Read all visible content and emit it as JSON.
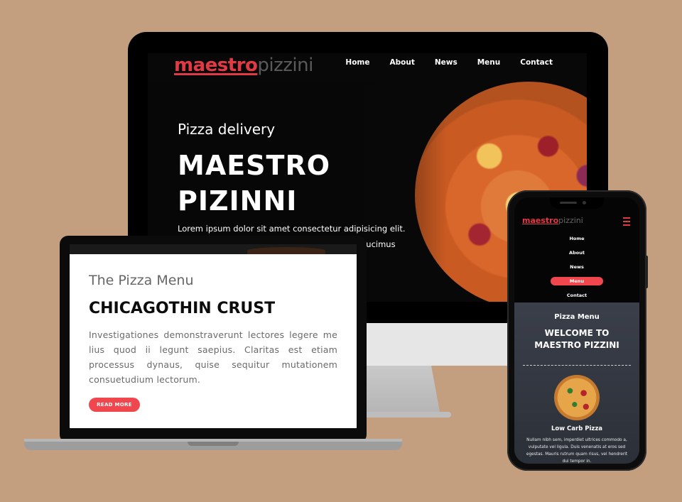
{
  "desktop": {
    "logo": {
      "part1": "maestro",
      "part2": "pizzini"
    },
    "nav": [
      "Home",
      "About",
      "News",
      "Menu",
      "Contact"
    ],
    "hero": {
      "subtitle": "Pizza delivery",
      "title_line1": "MAESTRO",
      "title_line2": "PIZINNI",
      "text": "Lorem ipsum dolor sit amet consectetur adipisicing elit.",
      "text2": "ducimus"
    }
  },
  "laptop": {
    "kicker": "The Pizza Menu",
    "title": "CHICAGOTHIN CRUST",
    "body": "Investigationes demonstraverunt lectores legere me lius quod ii legunt saepius. Claritas est etiam processus dynaus, quise sequitur mutationem consuetudium lectorum.",
    "button": "READ MORE"
  },
  "phone": {
    "logo": {
      "part1": "maestro",
      "part2": "pizzini"
    },
    "nav": [
      "Home",
      "About",
      "News",
      "Menu",
      "Contact"
    ],
    "active_nav": "Menu",
    "hero": {
      "kicker": "Pizza Menu",
      "title_line1": "WELCOME TO",
      "title_line2": "MAESTRO PIZZINI"
    },
    "item": {
      "name": "Low Carb Pizza",
      "desc": "Nullam nibh sem, imperdiet ultrices commodo a, vulputate vel ligula. Duis venenatis at eros sed egestas. Mauris rutrum quam risus, vel hendrerit dui tempor in."
    }
  },
  "colors": {
    "accent": "#f0474f",
    "background": "#c39f80",
    "logo_red": "#e23a45"
  }
}
